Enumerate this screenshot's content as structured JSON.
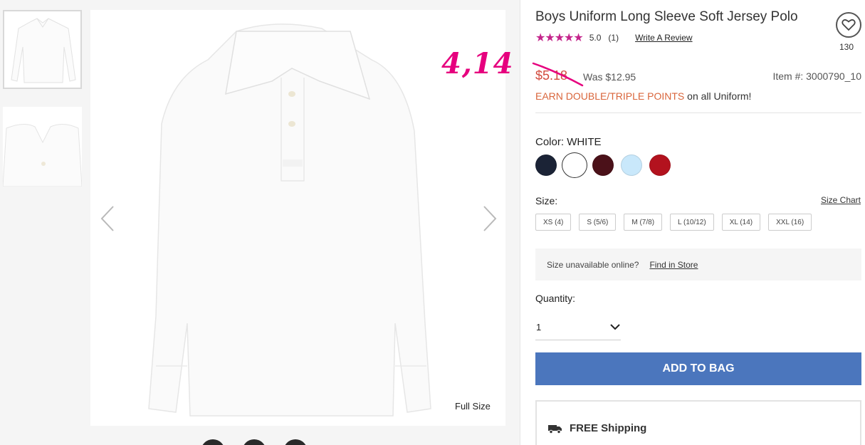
{
  "gallery": {
    "annotation": "4,14",
    "full_size_label": "Full Size"
  },
  "product": {
    "title": "Boys Uniform Long Sleeve Soft Jersey Polo",
    "rating": {
      "stars": "★★★★★",
      "score": "5.0",
      "count": "(1)",
      "write_review": "Write A Review"
    },
    "favorite_count": "130",
    "price": {
      "sale": "$5.18",
      "was": "Was $12.95",
      "item_number": "Item #: 3000790_10"
    },
    "promo": {
      "highlight": "EARN DOUBLE/TRIPLE POINTS",
      "rest": " on all Uniform!"
    },
    "color": {
      "label": "Color: ",
      "selected_name": "WHITE",
      "swatches": [
        "#1b2336",
        "#ffffff",
        "#4b1119",
        "#c9e8fb",
        "#b3121e"
      ]
    },
    "size": {
      "label": "Size:",
      "chart_link": "Size Chart",
      "options": [
        "XS (4)",
        "S (5/6)",
        "M (7/8)",
        "L (10/12)",
        "XL (14)",
        "XXL (16)"
      ]
    },
    "unavailable": {
      "text": "Size unavailable online?",
      "link": "Find in Store"
    },
    "quantity": {
      "label": "Quantity:",
      "value": "1"
    },
    "add_to_bag": "ADD TO BAG",
    "shipping": "FREE Shipping"
  },
  "colors": {
    "accent_blue": "#4b76bd",
    "sale_red": "#d24b3e",
    "promo_orange": "#d9653b",
    "star_magenta": "#c4258b",
    "annotation_pink": "#e6007e"
  }
}
